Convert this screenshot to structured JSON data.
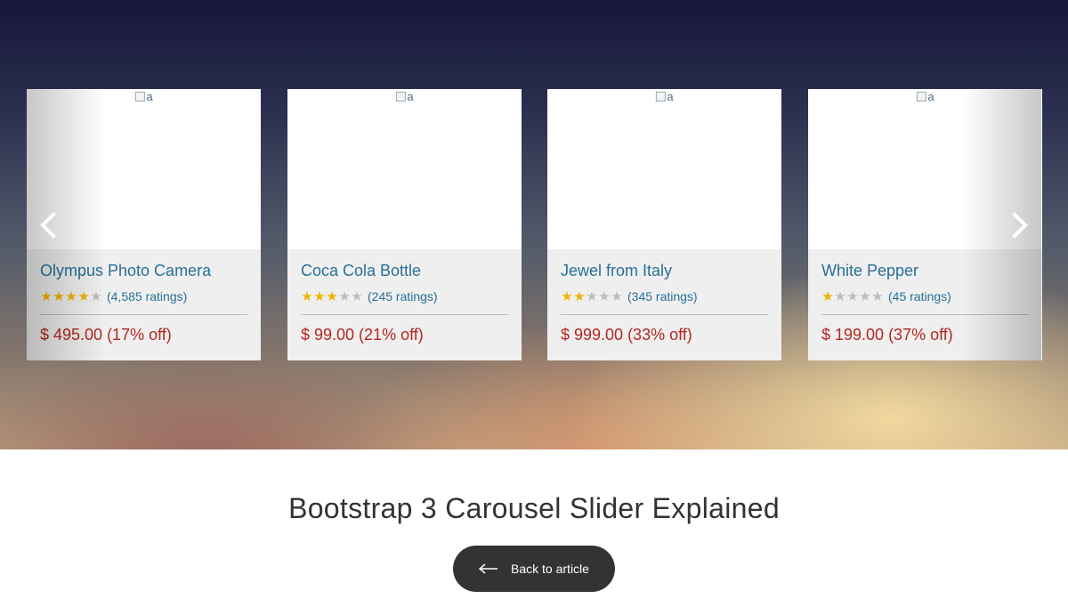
{
  "carousel": {
    "items": [
      {
        "image_alt": "a",
        "title": "Olympus Photo Camera",
        "stars": 4,
        "max_stars": 5,
        "ratings": "(4,585 ratings)",
        "price": "$ 495.00 (17% off)"
      },
      {
        "image_alt": "a",
        "title": "Coca Cola Bottle",
        "stars": 3,
        "max_stars": 5,
        "ratings": "(245 ratings)",
        "price": "$ 99.00 (21% off)"
      },
      {
        "image_alt": "a",
        "title": "Jewel from Italy",
        "stars": 2,
        "max_stars": 5,
        "ratings": "(345 ratings)",
        "price": "$ 999.00 (33% off)"
      },
      {
        "image_alt": "a",
        "title": "White Pepper",
        "stars": 1,
        "max_stars": 5,
        "ratings": "(45 ratings)",
        "price": "$ 199.00 (37% off)"
      }
    ],
    "prev_icon": "chevron-left-icon",
    "next_icon": "chevron-right-icon"
  },
  "colors": {
    "title_link": "#2a6f97",
    "price": "#b3261e",
    "star_on": "#f0b400",
    "star_off": "#bdbdbd",
    "button_bg": "#333333"
  },
  "footer": {
    "title": "Bootstrap 3 Carousel Slider Explained",
    "back_label": "Back to article",
    "back_icon": "arrow-left-icon"
  }
}
